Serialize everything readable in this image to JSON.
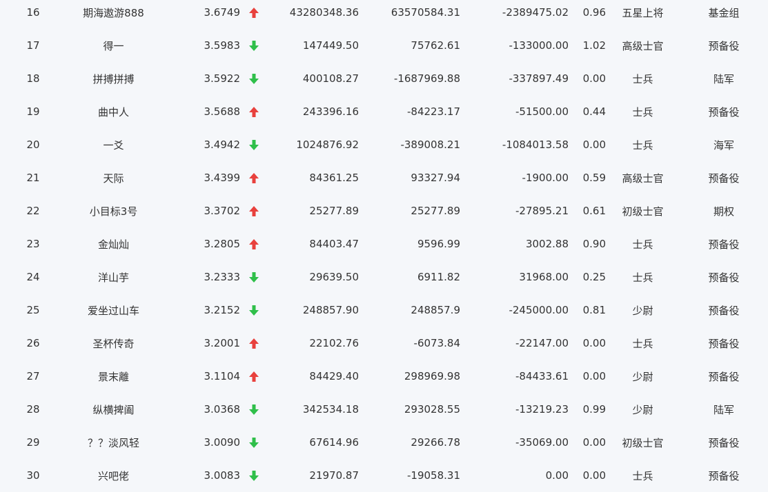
{
  "colors": {
    "up": "#e8413d",
    "down": "#2fbf4a",
    "text": "#333333",
    "background": "#f5f7fa"
  },
  "rows": [
    {
      "rank": "16",
      "name": "期海遨游888",
      "score": "3.6749",
      "trend": "up",
      "v1": "43280348.36",
      "v2": "63570584.31",
      "v3": "-2389475.02",
      "ratio": "0.96",
      "level": "五星上将",
      "group": "基金组"
    },
    {
      "rank": "17",
      "name": "得一",
      "score": "3.5983",
      "trend": "down",
      "v1": "147449.50",
      "v2": "75762.61",
      "v3": "-133000.00",
      "ratio": "1.02",
      "level": "高级士官",
      "group": "预备役"
    },
    {
      "rank": "18",
      "name": "拼搏拼搏",
      "score": "3.5922",
      "trend": "down",
      "v1": "400108.27",
      "v2": "-1687969.88",
      "v3": "-337897.49",
      "ratio": "0.00",
      "level": "士兵",
      "group": "陆军"
    },
    {
      "rank": "19",
      "name": "曲中人",
      "score": "3.5688",
      "trend": "up",
      "v1": "243396.16",
      "v2": "-84223.17",
      "v3": "-51500.00",
      "ratio": "0.44",
      "level": "士兵",
      "group": "预备役"
    },
    {
      "rank": "20",
      "name": "一爻",
      "score": "3.4942",
      "trend": "down",
      "v1": "1024876.92",
      "v2": "-389008.21",
      "v3": "-1084013.58",
      "ratio": "0.00",
      "level": "士兵",
      "group": "海军"
    },
    {
      "rank": "21",
      "name": "天际",
      "score": "3.4399",
      "trend": "up",
      "v1": "84361.25",
      "v2": "93327.94",
      "v3": "-1900.00",
      "ratio": "0.59",
      "level": "高级士官",
      "group": "预备役"
    },
    {
      "rank": "22",
      "name": "小目标3号",
      "score": "3.3702",
      "trend": "up",
      "v1": "25277.89",
      "v2": "25277.89",
      "v3": "-27895.21",
      "ratio": "0.61",
      "level": "初级士官",
      "group": "期权"
    },
    {
      "rank": "23",
      "name": "金灿灿",
      "score": "3.2805",
      "trend": "up",
      "v1": "84403.47",
      "v2": "9596.99",
      "v3": "3002.88",
      "ratio": "0.90",
      "level": "士兵",
      "group": "预备役"
    },
    {
      "rank": "24",
      "name": "洋山芋",
      "score": "3.2333",
      "trend": "down",
      "v1": "29639.50",
      "v2": "6911.82",
      "v3": "31968.00",
      "ratio": "0.25",
      "level": "士兵",
      "group": "预备役"
    },
    {
      "rank": "25",
      "name": "爱坐过山车",
      "score": "3.2152",
      "trend": "down",
      "v1": "248857.90",
      "v2": "248857.9",
      "v3": "-245000.00",
      "ratio": "0.81",
      "level": "少尉",
      "group": "预备役"
    },
    {
      "rank": "26",
      "name": "圣杯传奇",
      "score": "3.2001",
      "trend": "up",
      "v1": "22102.76",
      "v2": "-6073.84",
      "v3": "-22147.00",
      "ratio": "0.00",
      "level": "士兵",
      "group": "预备役"
    },
    {
      "rank": "27",
      "name": "景末離",
      "score": "3.1104",
      "trend": "up",
      "v1": "84429.40",
      "v2": "298969.98",
      "v3": "-84433.61",
      "ratio": "0.00",
      "level": "少尉",
      "group": "预备役"
    },
    {
      "rank": "28",
      "name": "纵横捭阖",
      "score": "3.0368",
      "trend": "down",
      "v1": "342534.18",
      "v2": "293028.55",
      "v3": "-13219.23",
      "ratio": "0.99",
      "level": "少尉",
      "group": "陆军"
    },
    {
      "rank": "29",
      "name": "？？淡风轻",
      "score": "3.0090",
      "trend": "down",
      "v1": "67614.96",
      "v2": "29266.78",
      "v3": "-35069.00",
      "ratio": "0.00",
      "level": "初级士官",
      "group": "预备役"
    },
    {
      "rank": "30",
      "name": "兴吧佬",
      "score": "3.0083",
      "trend": "down",
      "v1": "21970.87",
      "v2": "-19058.31",
      "v3": "0.00",
      "ratio": "0.00",
      "level": "士兵",
      "group": "预备役"
    }
  ]
}
